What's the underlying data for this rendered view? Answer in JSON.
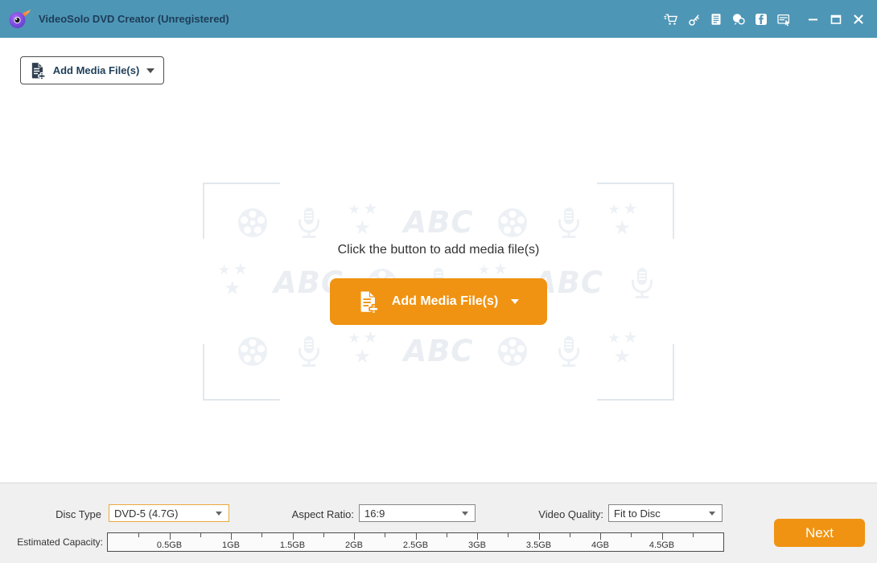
{
  "titlebar": {
    "title": "VideoSolo DVD Creator (Unregistered)",
    "icons": [
      "cart",
      "key",
      "document",
      "feedback-chat",
      "facebook",
      "form-cursor"
    ],
    "window_controls": [
      "minimize",
      "maximize",
      "close"
    ]
  },
  "toolbar": {
    "add_media_label": "Add Media File(s)"
  },
  "main": {
    "hint_text": "Click the button to add media file(s)",
    "add_media_label": "Add Media File(s)",
    "watermark": {
      "abc_text": "ABC",
      "star_glyph": "★",
      "rows": [
        [
          "film",
          "mic",
          "stars",
          "abc",
          "film",
          "mic",
          "stars"
        ],
        [
          "stars",
          "abc",
          "film",
          "mic",
          "stars",
          "abc",
          "mic"
        ],
        [
          "film",
          "mic",
          "stars",
          "abc",
          "film",
          "mic",
          "stars"
        ]
      ]
    }
  },
  "settings": {
    "disc_type_label": "Disc Type",
    "disc_type_value": "DVD-5 (4.7G)",
    "aspect_ratio_label": "Aspect Ratio:",
    "aspect_ratio_value": "16:9",
    "video_quality_label": "Video Quality:",
    "video_quality_value": "Fit to Disc",
    "capacity_label": "Estimated Capacity:",
    "capacity_tick_labels": [
      "0.5GB",
      "1GB",
      "1.5GB",
      "2GB",
      "2.5GB",
      "3GB",
      "3.5GB",
      "4GB",
      "4.5GB"
    ],
    "next_label": "Next"
  },
  "colors": {
    "titlebar_bg": "#4E96B6",
    "title_text": "#1D3D58",
    "accent_orange": "#F09312",
    "disc_select_border": "#E9A83C",
    "watermark": "#EDF1F5",
    "bottom_bg": "#F0F0F0"
  }
}
